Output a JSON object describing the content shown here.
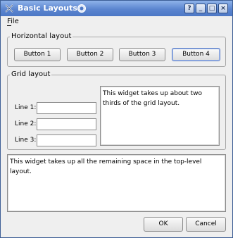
{
  "window": {
    "title": "Basic Layouts"
  },
  "titlebar_buttons": [
    "?",
    "_",
    "□",
    "×"
  ],
  "menu": {
    "file": "File"
  },
  "horizontal_group": {
    "title": "Horizontal layout",
    "buttons": [
      "Button 1",
      "Button 2",
      "Button 3",
      "Button 4"
    ]
  },
  "grid_group": {
    "title": "Grid layout",
    "lines": [
      {
        "label": "Line 1:",
        "value": ""
      },
      {
        "label": "Line 2:",
        "value": ""
      },
      {
        "label": "Line 3:",
        "value": ""
      }
    ],
    "side_text": "This widget takes up about two thirds of the grid layout."
  },
  "big_text": "This widget takes up all the remaining space in the top-level layout.",
  "dialog_buttons": {
    "ok": "OK",
    "cancel": "Cancel"
  },
  "colors": {
    "titlebar": "#5b85cf",
    "background": "#efefef"
  },
  "icons": {
    "app": "kde-x-icon",
    "logo": "kde-gear-logo-icon"
  }
}
